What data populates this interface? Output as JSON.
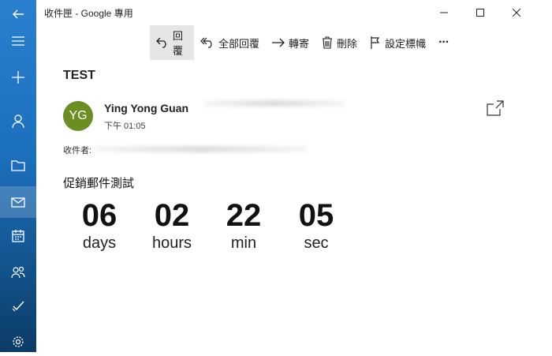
{
  "window": {
    "title": "收件匣 - Google 專用"
  },
  "toolbar": {
    "reply": "回覆",
    "reply_all": "全部回覆",
    "forward": "轉寄",
    "delete": "刪除",
    "flag": "設定標幟",
    "more": "···"
  },
  "message": {
    "subject": "TEST",
    "avatar_initials": "YG",
    "sender_name": "Ying Yong Guan",
    "time": "下午 01:05",
    "to_label": "收件者:",
    "body_title": "促銷郵件測試",
    "countdown": [
      {
        "value": "06",
        "unit": "days"
      },
      {
        "value": "02",
        "unit": "hours"
      },
      {
        "value": "22",
        "unit": "min"
      },
      {
        "value": "05",
        "unit": "sec"
      }
    ]
  },
  "icons": {
    "sidebar": [
      "back-arrow-icon",
      "hamburger-menu-icon",
      "new-mail-plus-icon",
      "account-person-icon",
      "folder-icon",
      "mail-icon",
      "calendar-icon",
      "people-icon",
      "todo-check-icon",
      "settings-gear-icon"
    ]
  },
  "colors": {
    "sidebar_top": "#2a7fcf",
    "sidebar_bottom": "#0c3b66",
    "avatar": "#6b8e23",
    "hover_bg": "#e6e6e6"
  }
}
